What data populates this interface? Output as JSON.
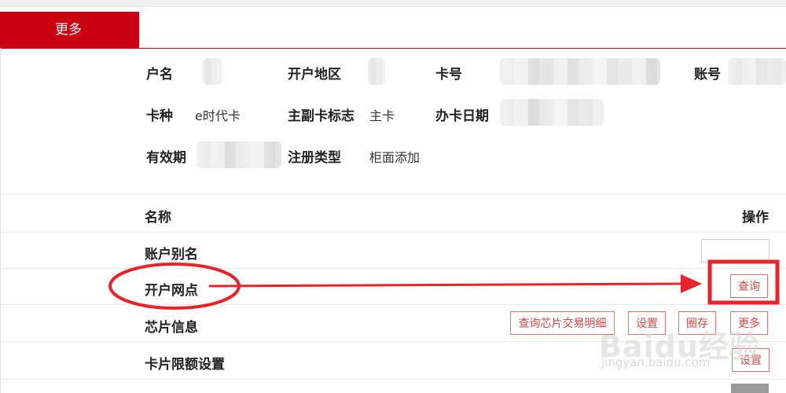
{
  "tab": {
    "label": "更多"
  },
  "info": {
    "row1": [
      {
        "label": "户名"
      },
      {
        "label": "开户地区"
      },
      {
        "label": "卡号"
      },
      {
        "label": "账号"
      }
    ],
    "row2": [
      {
        "label": "卡种",
        "value": "e时代卡"
      },
      {
        "label": "主副卡标志",
        "value": "主卡"
      },
      {
        "label": "办卡日期"
      }
    ],
    "row3": [
      {
        "label": "有效期"
      },
      {
        "label": "注册类型",
        "value": "柜面添加"
      }
    ]
  },
  "table": {
    "col_name": "名称",
    "col_action": "操作",
    "rows": [
      {
        "name": "账户别名"
      },
      {
        "name": "开户网点",
        "buttons": [
          "查询"
        ]
      },
      {
        "name": "芯片信息",
        "buttons": [
          "查询芯片交易明细",
          "设置",
          "圈存",
          "更多"
        ]
      },
      {
        "name": "卡片限额设置",
        "buttons": [
          "设置"
        ]
      }
    ]
  },
  "annotation": {
    "color": "#e8232a"
  },
  "watermark": {
    "brand": "Baidu经验",
    "url": "jingyan.baidu.com"
  },
  "colors": {
    "accent": "#c8000f",
    "button_border": "#e07474"
  }
}
